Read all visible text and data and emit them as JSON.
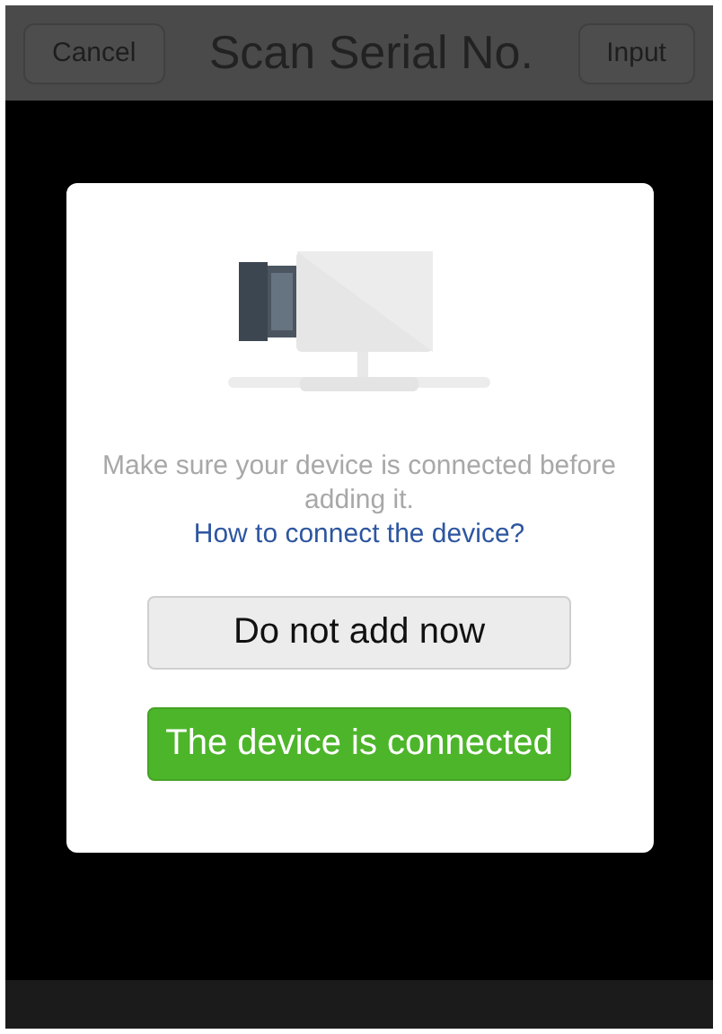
{
  "nav_bar": {
    "left_button": "Cancel",
    "title": "Scan Serial No.",
    "right_button": "Input"
  },
  "dialog": {
    "message": "Make sure your device is connected before adding it.",
    "link": "How to connect the device?",
    "buttons": [
      {
        "label": "Do not add now",
        "kind": "secondary"
      },
      {
        "label": "The device is connected",
        "kind": "primary"
      }
    ]
  }
}
